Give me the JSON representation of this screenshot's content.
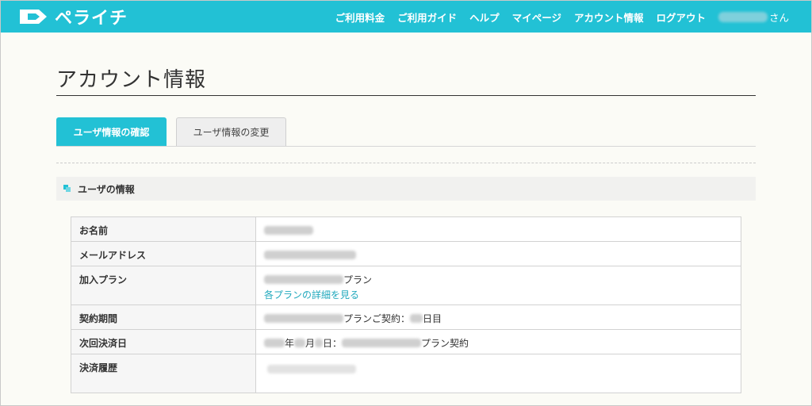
{
  "header": {
    "logo_text": "ペライチ",
    "nav": [
      "ご利用料金",
      "ご利用ガイド",
      "ヘルプ",
      "マイページ",
      "アカウント情報",
      "ログアウト"
    ],
    "user_suffix": "さん",
    "brand_color": "#22c1d5"
  },
  "page": {
    "title": "アカウント情報"
  },
  "tabs": [
    {
      "label": "ユーザ情報の確認",
      "active": true
    },
    {
      "label": "ユーザ情報の変更",
      "active": false
    }
  ],
  "section": {
    "title": "ユーザの情報"
  },
  "table": {
    "rows": [
      {
        "label": "お名前"
      },
      {
        "label": "メールアドレス"
      },
      {
        "label": "加入プラン",
        "suffix": "プラン",
        "link": "各プランの詳細を見る"
      },
      {
        "label": "契約期間",
        "mid": "プランご契約：",
        "suffix": "日目"
      },
      {
        "label": "次回決済日",
        "year": "年",
        "month": "月",
        "day": "日：",
        "suffix": "プラン契約"
      },
      {
        "label": "決済履歴"
      }
    ]
  }
}
